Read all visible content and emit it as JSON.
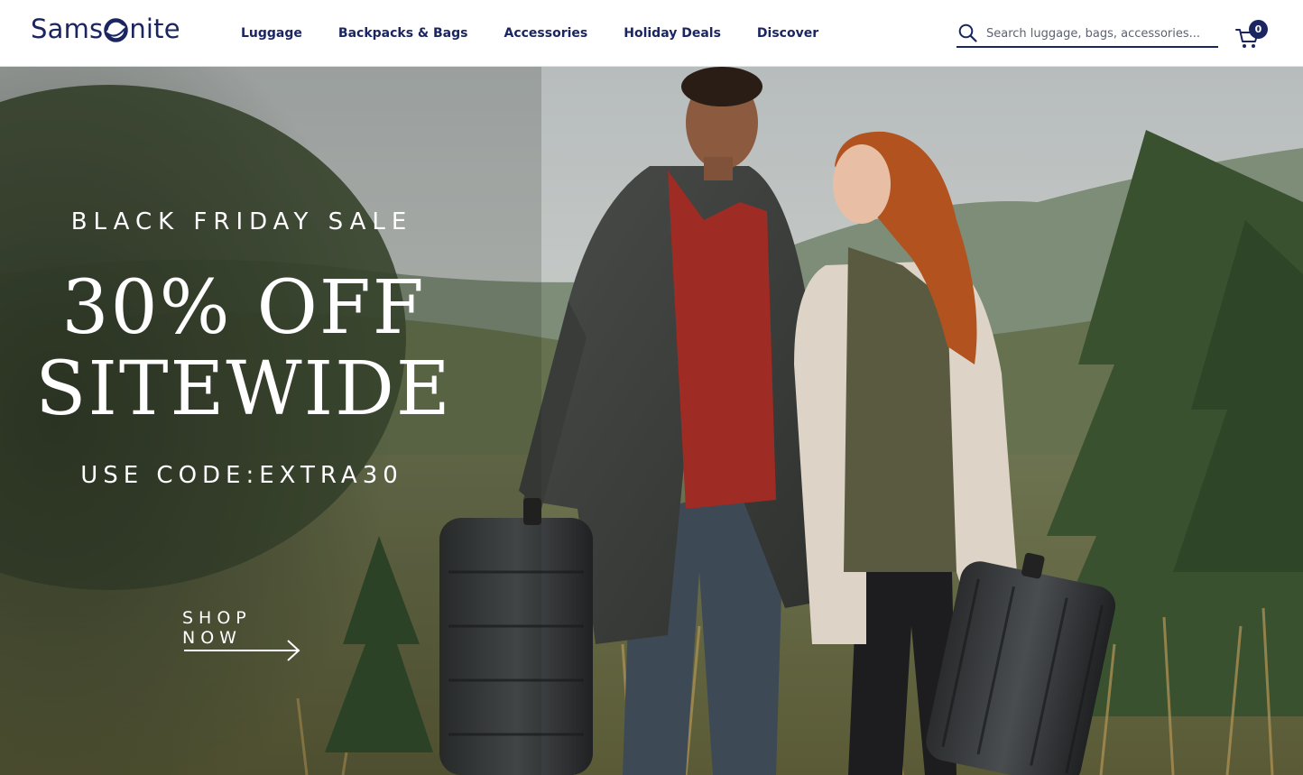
{
  "header": {
    "logo_text_left": "Sams",
    "logo_text_right": "nite",
    "brand_color": "#1b2660",
    "nav": [
      {
        "label": "Luggage"
      },
      {
        "label": "Backpacks & Bags"
      },
      {
        "label": "Accessories"
      },
      {
        "label": "Holiday Deals"
      },
      {
        "label": "Discover"
      }
    ],
    "search": {
      "placeholder": "Search luggage, bags, accessories...",
      "icon": "search-icon"
    },
    "cart": {
      "icon": "cart-icon",
      "count": "0"
    }
  },
  "hero": {
    "eyebrow": "BLACK FRIDAY SALE",
    "headline_line1": "30% OFF",
    "headline_line2": "SITEWIDE",
    "code_text": "USE CODE:EXTRA30",
    "cta_label": "SHOP NOW",
    "cta_icon": "arrow-right-icon"
  }
}
